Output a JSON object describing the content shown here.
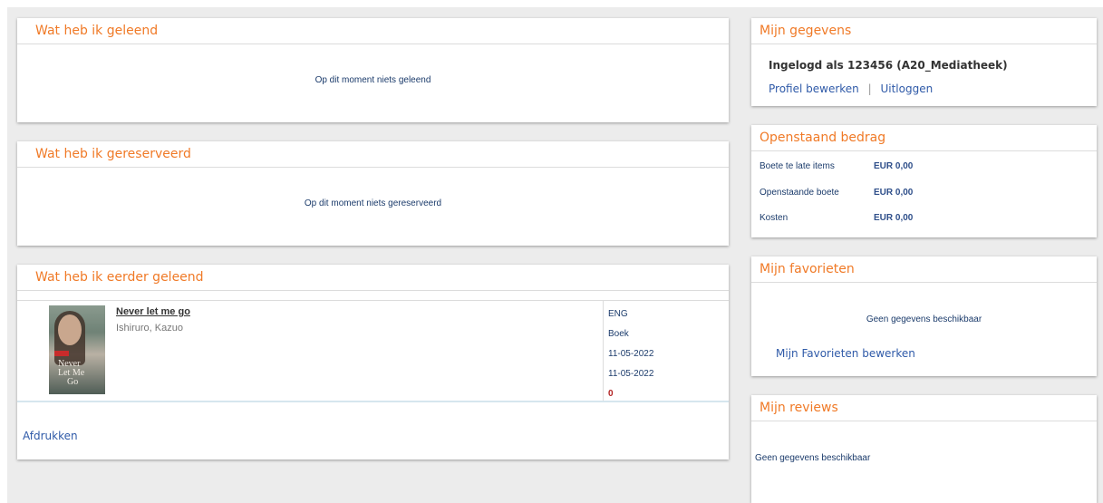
{
  "left": {
    "borrowed": {
      "title": "Wat heb ik geleend",
      "empty_message": "Op dit moment niets geleend"
    },
    "reserved": {
      "title": "Wat heb ik gereserveerd",
      "empty_message": "Op dit moment niets gereserveerd"
    },
    "history": {
      "title": "Wat heb ik eerder geleend",
      "items": [
        {
          "title": "Never let me go",
          "author": "Ishiruro, Kazuo",
          "cover_text": [
            "Never",
            "Let Me",
            "Go"
          ],
          "language": "ENG",
          "type": "Boek",
          "date_1": "11-05-2022",
          "date_2": "11-05-2022",
          "count": "0"
        }
      ],
      "print_link": "Afdrukken"
    }
  },
  "right": {
    "account": {
      "title": "Mijn gegevens",
      "logged_in_text": "Ingelogd als 123456 (A20_Mediatheek)",
      "edit_profile": "Profiel bewerken",
      "separator": "|",
      "logout": "Uitloggen"
    },
    "balance": {
      "title": "Openstaand bedrag",
      "rows": [
        {
          "label": "Boete te late items",
          "value": "EUR 0,00"
        },
        {
          "label": "Openstaande boete",
          "value": "EUR 0,00"
        },
        {
          "label": "Kosten",
          "value": "EUR 0,00"
        }
      ]
    },
    "favorites": {
      "title": "Mijn favorieten",
      "empty_message": "Geen gegevens beschikbaar",
      "edit_link": "Mijn Favorieten bewerken"
    },
    "reviews": {
      "title": "Mijn reviews",
      "empty_message": "Geen gegevens beschikbaar"
    }
  },
  "colors": {
    "accent": "#f07a27",
    "link": "#2f5aa8",
    "text_dark": "#1b3b6b",
    "background": "#ececec"
  }
}
